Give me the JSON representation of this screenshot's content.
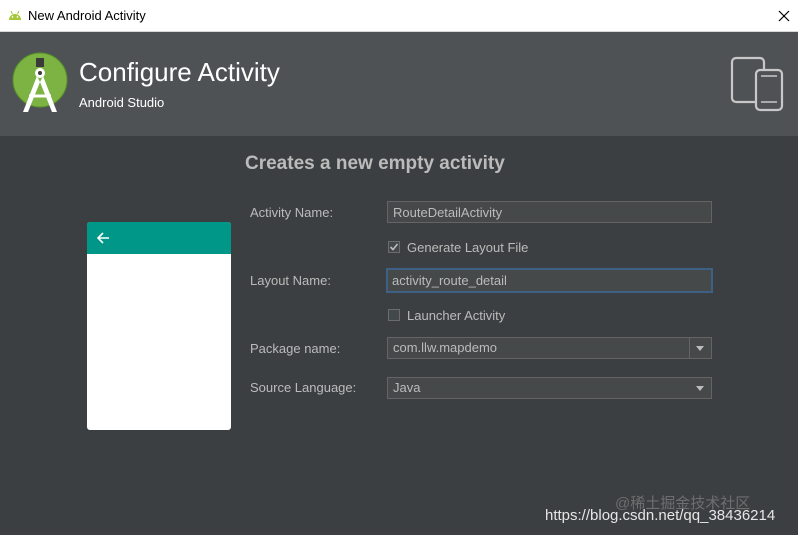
{
  "window": {
    "title": "New Android Activity",
    "close_glyph": "✕"
  },
  "header": {
    "title": "Configure Activity",
    "subtitle": "Android Studio",
    "logo_icon": "android-studio-logo-icon",
    "devices_icon": "devices-icon"
  },
  "content": {
    "subtitle": "Creates a new empty activity",
    "preview": {
      "appbar_color": "#009688",
      "back_icon": "arrow-left-icon"
    },
    "form": {
      "activity_name_label": "Activity Name:",
      "activity_name_value": "RouteDetailActivity",
      "generate_layout_label": "Generate Layout File",
      "generate_layout_checked": true,
      "layout_name_label": "Layout Name:",
      "layout_name_value": "activity_route_detail",
      "launcher_label": "Launcher Activity",
      "launcher_checked": false,
      "package_label": "Package name:",
      "package_value": "com.llw.mapdemo",
      "source_language_label": "Source Language:",
      "source_language_value": "Java"
    }
  },
  "watermark": {
    "faint_text": "@稀土掘金技术社区",
    "url_text": "https://blog.csdn.net/qq_38436214"
  },
  "colors": {
    "header_bg": "#4e5254",
    "content_bg": "#3c3f41",
    "text": "#bbbbbb",
    "focus_border": "#3d6185",
    "android_green": "#a4c639"
  }
}
